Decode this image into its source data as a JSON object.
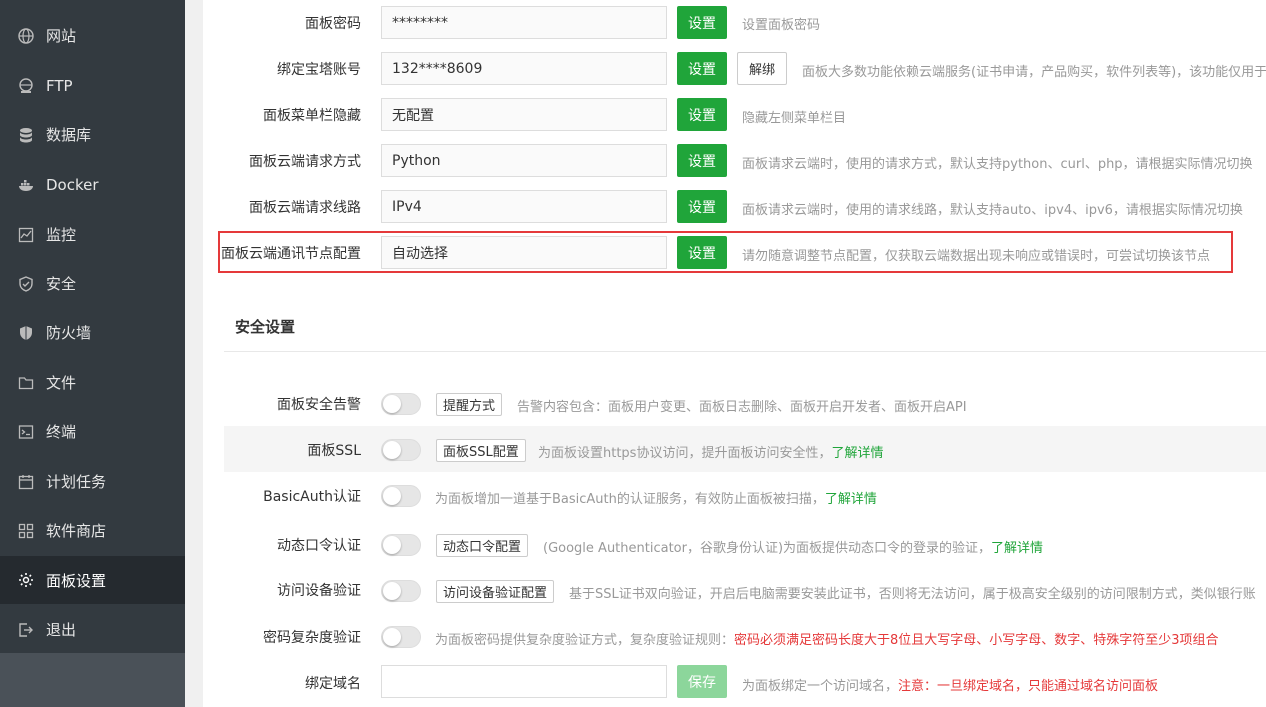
{
  "sidebar": {
    "items": [
      {
        "label": "网站",
        "icon": "globe-icon"
      },
      {
        "label": "FTP",
        "icon": "ftp-globe-icon"
      },
      {
        "label": "数据库",
        "icon": "database-icon"
      },
      {
        "label": "Docker",
        "icon": "docker-icon"
      },
      {
        "label": "监控",
        "icon": "monitor-icon"
      },
      {
        "label": "安全",
        "icon": "shield-icon"
      },
      {
        "label": "防火墙",
        "icon": "firewall-shield-icon"
      },
      {
        "label": "文件",
        "icon": "folder-icon"
      },
      {
        "label": "终端",
        "icon": "terminal-icon"
      },
      {
        "label": "计划任务",
        "icon": "calendar-icon"
      },
      {
        "label": "软件商店",
        "icon": "grid-icon"
      },
      {
        "label": "面板设置",
        "icon": "gear-icon"
      },
      {
        "label": "退出",
        "icon": "logout-icon"
      }
    ],
    "active_index": 11
  },
  "panel_rows": [
    {
      "label": "面板密码",
      "value": "********",
      "button": "设置",
      "desc": "设置面板密码"
    },
    {
      "label": "绑定宝塔账号",
      "value": "132****8609",
      "button": "设置",
      "button2": "解绑",
      "desc": "面板大多数功能依赖云端服务(证书申请，产品购买，软件列表等)，该功能仅用于"
    },
    {
      "label": "面板菜单栏隐藏",
      "value": "无配置",
      "button": "设置",
      "desc": "隐藏左侧菜单栏目"
    },
    {
      "label": "面板云端请求方式",
      "value": "Python",
      "button": "设置",
      "desc": "面板请求云端时，使用的请求方式，默认支持python、curl、php，请根据实际情况切换"
    },
    {
      "label": "面板云端请求线路",
      "value": "IPv4",
      "button": "设置",
      "desc": "面板请求云端时，使用的请求线路，默认支持auto、ipv4、ipv6，请根据实际情况切换"
    },
    {
      "label": "面板云端通讯节点配置",
      "value": "自动选择",
      "button": "设置",
      "desc": "请勿随意调整节点配置，仅获取云端数据出现未响应或错误时，可尝试切换该节点"
    }
  ],
  "security": {
    "title": "安全设置",
    "rows": [
      {
        "label": "面板安全告警",
        "button": "提醒方式",
        "desc": "告警内容包含：面板用户变更、面板日志删除、面板开启开发者、面板开启API",
        "enabled": false
      },
      {
        "label": "面板SSL",
        "button": "面板SSL配置",
        "desc": "为面板设置https协议访问，提升面板访问安全性，",
        "link": "了解详情",
        "enabled": false
      },
      {
        "label": "BasicAuth认证",
        "desc": "为面板增加一道基于BasicAuth的认证服务，有效防止面板被扫描，",
        "link": "了解详情",
        "enabled": false
      },
      {
        "label": "动态口令认证",
        "button": "动态口令配置",
        "desc": "(Google Authenticator，谷歌身份认证)为面板提供动态口令的登录的验证，",
        "link": "了解详情",
        "enabled": false
      },
      {
        "label": "访问设备验证",
        "button": "访问设备验证配置",
        "desc": "基于SSL证书双向验证，开启后电脑需要安装此证书，否则将无法访问，属于极高安全级别的访问限制方式，类似银行账",
        "enabled": false
      },
      {
        "label": "密码复杂度验证",
        "desc": "为面板密码提供复杂度验证方式，复杂度验证规则：",
        "desc_red": "密码必须满足密码长度大于8位且大写字母、小写字母、数字、特殊字符至少3项组合",
        "enabled": false
      }
    ],
    "domain": {
      "label": "绑定域名",
      "value": "",
      "button": "保存",
      "desc": "为面板绑定一个访问域名，",
      "desc_red": "注意：一旦绑定域名，只能通过域名访问面板"
    }
  },
  "colors": {
    "sidebar_bg": "#333a40",
    "active_bg": "#252a2f",
    "accent": "#20a53a",
    "highlight": "#e5393a"
  }
}
